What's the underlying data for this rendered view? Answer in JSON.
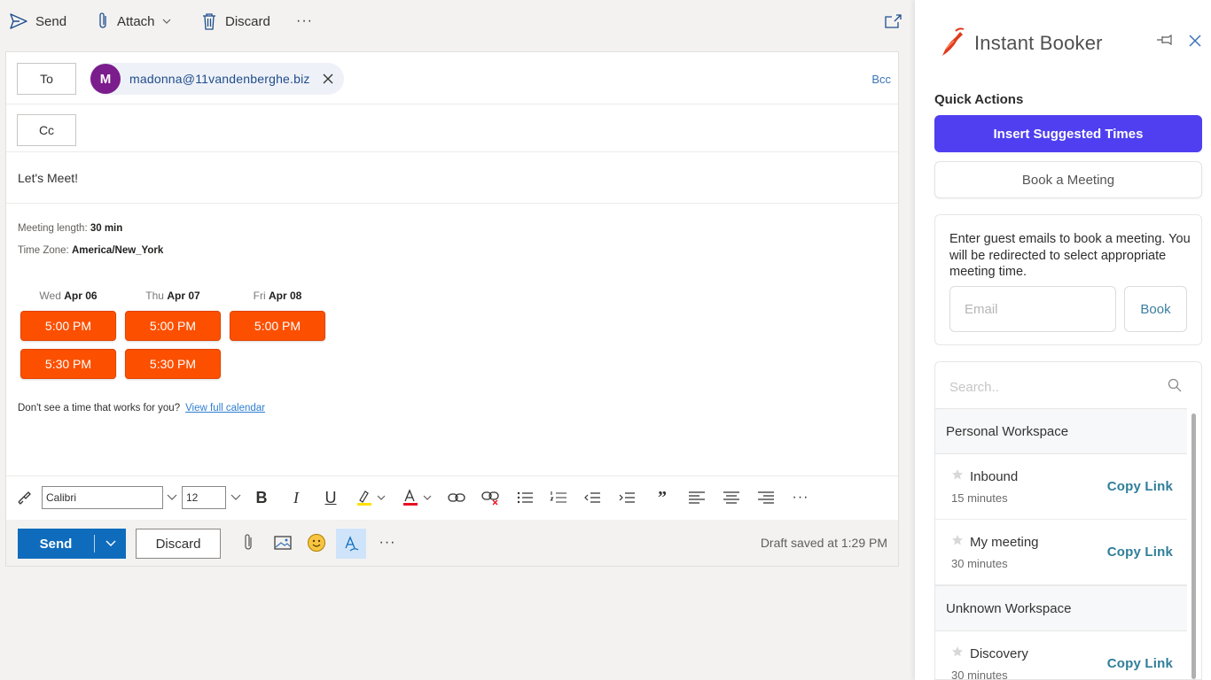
{
  "toolbar": {
    "send": "Send",
    "attach": "Attach",
    "discard": "Discard",
    "more": "···"
  },
  "compose": {
    "to_label": "To",
    "cc_label": "Cc",
    "bcc_label": "Bcc",
    "recipient": {
      "initial": "M",
      "email": "madonna@11vandenberghe.biz",
      "avatar_color": "#7b1d8c"
    },
    "subject": "Let's Meet!",
    "meeting_length_label": "Meeting length:",
    "meeting_length_value": "30 min",
    "timezone_label": "Time Zone:",
    "timezone_value": "America/New_York",
    "days": [
      {
        "weekday": "Wed",
        "date": "Apr 06",
        "slots": [
          "5:00 PM",
          "5:30 PM"
        ]
      },
      {
        "weekday": "Thu",
        "date": "Apr 07",
        "slots": [
          "5:00 PM",
          "5:30 PM"
        ]
      },
      {
        "weekday": "Fri",
        "date": "Apr 08",
        "slots": [
          "5:00 PM"
        ]
      }
    ],
    "no_time_text": "Don't see a time that works for you?",
    "full_calendar_link": "View full calendar",
    "slot_color": "#fc5000"
  },
  "format": {
    "font": "Calibri",
    "size": "12",
    "more": "···"
  },
  "send_row": {
    "send": "Send",
    "discard": "Discard",
    "more": "···",
    "draft_status": "Draft saved at 1:29 PM"
  },
  "panel": {
    "title": "Instant Booker",
    "quick_actions": "Quick Actions",
    "insert_times": "Insert Suggested Times",
    "book_meeting": "Book a Meeting",
    "guest_text": "Enter guest emails to book a meeting. You will be redirected to select appropriate meeting time.",
    "email_placeholder": "Email",
    "book": "Book",
    "search_placeholder": "Search..",
    "accent_color": "#4f3ff0",
    "workspaces": [
      {
        "name": "Personal Workspace",
        "events": [
          {
            "name": "Inbound",
            "duration": "15 minutes",
            "action": "Copy Link"
          },
          {
            "name": "My meeting",
            "duration": "30 minutes",
            "action": "Copy Link"
          }
        ]
      },
      {
        "name": "Unknown Workspace",
        "events": [
          {
            "name": "Discovery",
            "duration": "30 minutes",
            "action": "Copy Link"
          }
        ]
      }
    ]
  }
}
